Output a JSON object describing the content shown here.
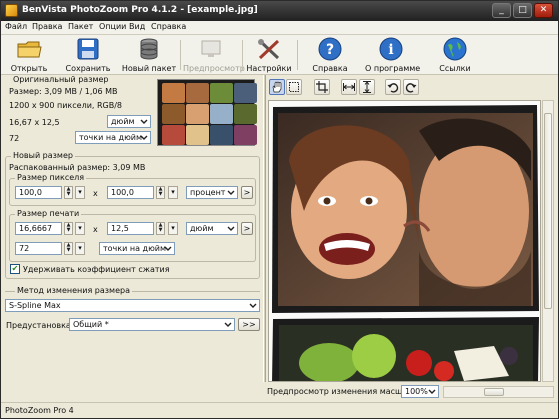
{
  "app": {
    "title": "BenVista PhotoZoom Pro 4.1.2 - [example.jpg]"
  },
  "window_controls": {
    "minimize": "_",
    "maximize": "□",
    "close": "✕"
  },
  "menu": [
    "Файл",
    "Правка",
    "Пакет",
    "Опции",
    "Вид",
    "Справка"
  ],
  "toolbar": {
    "open": "Открыть",
    "save": "Сохранить",
    "new_batch": "Новый пакет",
    "preview": "Предпросмотр",
    "settings": "Настройки",
    "help": "Справка",
    "about": "О программе",
    "links": "Ссылки"
  },
  "original": {
    "title": "Оригинальный размер",
    "size_line": "Размер: 3,09 MB / 1,06 MB",
    "pixels_line": "1200 x 900 пиксели, RGB/8",
    "dims": "16,67 x 12,5",
    "dims_unit": "дюйм",
    "res": "72",
    "res_unit": "точки на дюйм"
  },
  "new_size": {
    "title": "Новый размер",
    "unpacked": "Распакованный размер: 3,09 MB",
    "pixel_group": "Размер пикселя",
    "px_w": "100,0",
    "px_h": "100,0",
    "x_sep": "x",
    "px_unit": "процент",
    "print_group": "Размер печати",
    "print_w": "16,6667",
    "print_h": "12,5",
    "print_unit": "дюйм",
    "res": "72",
    "res_unit": "точки на дюйм",
    "keep_ratio": "Удерживать коэффициент сжатия",
    "keep_ratio_checked": true,
    "link_label": ">"
  },
  "method": {
    "title": "Метод изменения размера",
    "value": "S-Spline Max",
    "preset_label": "Предустановка:",
    "preset_value": "Общий *",
    "preset_button": ">>"
  },
  "preview_footer": {
    "label": "Предпросмотр изменения масштаба:",
    "zoom": "100%"
  },
  "status": {
    "text": "PhotoZoom Pro 4"
  },
  "colors": {
    "accent": "#2f6fc6",
    "frame": "#1b1b1b"
  }
}
